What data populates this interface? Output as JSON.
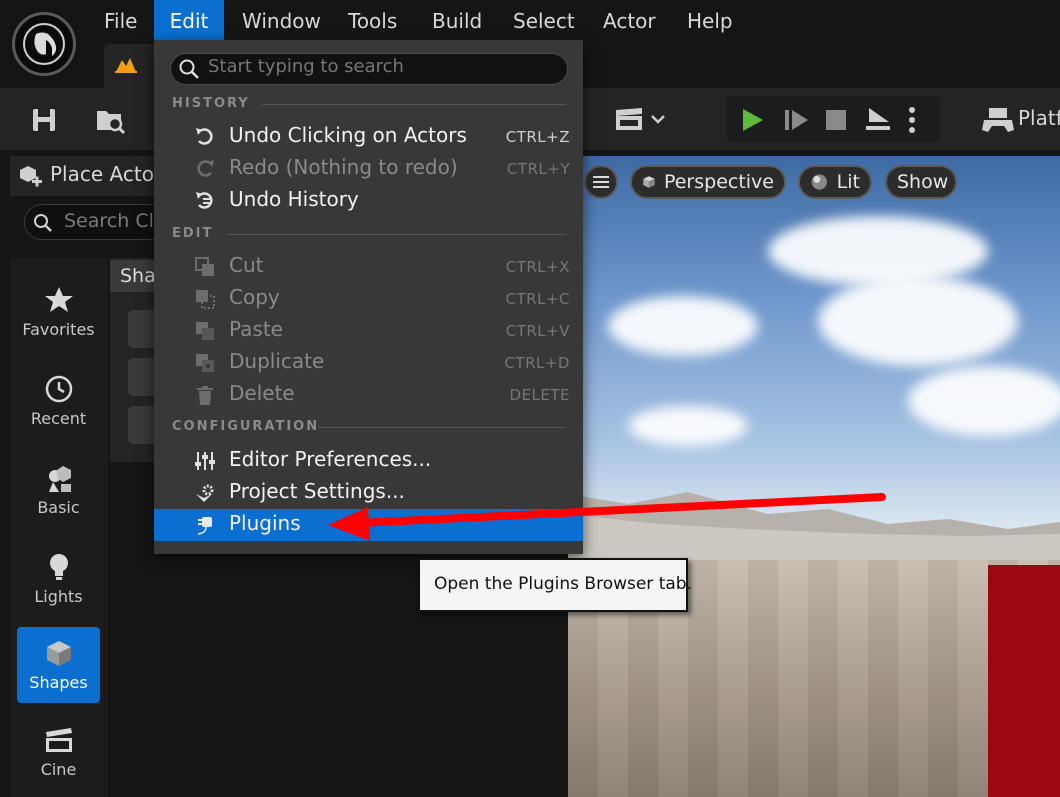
{
  "menu": {
    "items": [
      {
        "label": "File"
      },
      {
        "label": "Edit"
      },
      {
        "label": "Window"
      },
      {
        "label": "Tools"
      },
      {
        "label": "Build"
      },
      {
        "label": "Select"
      },
      {
        "label": "Actor"
      },
      {
        "label": "Help"
      }
    ],
    "active": "Edit"
  },
  "toolbar": {
    "platforms_label": "Platf"
  },
  "left_panel": {
    "title": "Place Actor",
    "search_placeholder": "Search Cla",
    "shapes_tab_label": "Sha",
    "categories": [
      {
        "label": "Favorites",
        "icon": "star-icon"
      },
      {
        "label": "Recent",
        "icon": "clock-icon"
      },
      {
        "label": "Basic",
        "icon": "basic-shapes-icon"
      },
      {
        "label": "Lights",
        "icon": "lightbulb-icon"
      },
      {
        "label": "Shapes",
        "icon": "cube-icon"
      },
      {
        "label": "Cine",
        "icon": "clapperboard-icon"
      }
    ],
    "selected_category": "Shapes"
  },
  "viewport": {
    "perspective_label": "Perspective",
    "lit_label": "Lit",
    "show_label": "Show"
  },
  "edit_menu": {
    "search_placeholder": "Start typing to search",
    "sections": {
      "history": "HISTORY",
      "edit": "EDIT",
      "configuration": "CONFIGURATION"
    },
    "items": {
      "undo": {
        "label": "Undo Clicking on Actors",
        "shortcut": "CTRL+Z",
        "icon": "undo-icon"
      },
      "redo": {
        "label": "Redo (Nothing to redo)",
        "shortcut": "CTRL+Y",
        "icon": "redo-icon"
      },
      "undo_history": {
        "label": "Undo History",
        "icon": "undo-history-icon"
      },
      "cut": {
        "label": "Cut",
        "shortcut": "CTRL+X",
        "icon": "cut-icon"
      },
      "copy": {
        "label": "Copy",
        "shortcut": "CTRL+C",
        "icon": "copy-icon"
      },
      "paste": {
        "label": "Paste",
        "shortcut": "CTRL+V",
        "icon": "paste-icon"
      },
      "duplicate": {
        "label": "Duplicate",
        "shortcut": "CTRL+D",
        "icon": "duplicate-icon"
      },
      "delete": {
        "label": "Delete",
        "shortcut": "DELETE",
        "icon": "trash-icon"
      },
      "editor_prefs": {
        "label": "Editor Preferences...",
        "icon": "sliders-icon"
      },
      "project_settings": {
        "label": "Project Settings...",
        "icon": "gear-icon"
      },
      "plugins": {
        "label": "Plugins",
        "icon": "plug-icon"
      }
    },
    "highlighted": "Plugins"
  },
  "tooltip": {
    "text": "Open the Plugins Browser tab."
  },
  "colors": {
    "accent": "#0b6fd1",
    "play_green": "#5dbb3a",
    "annotation_arrow": "#ff0000",
    "panel_bg": "#242424",
    "menu_bg": "#383838"
  }
}
